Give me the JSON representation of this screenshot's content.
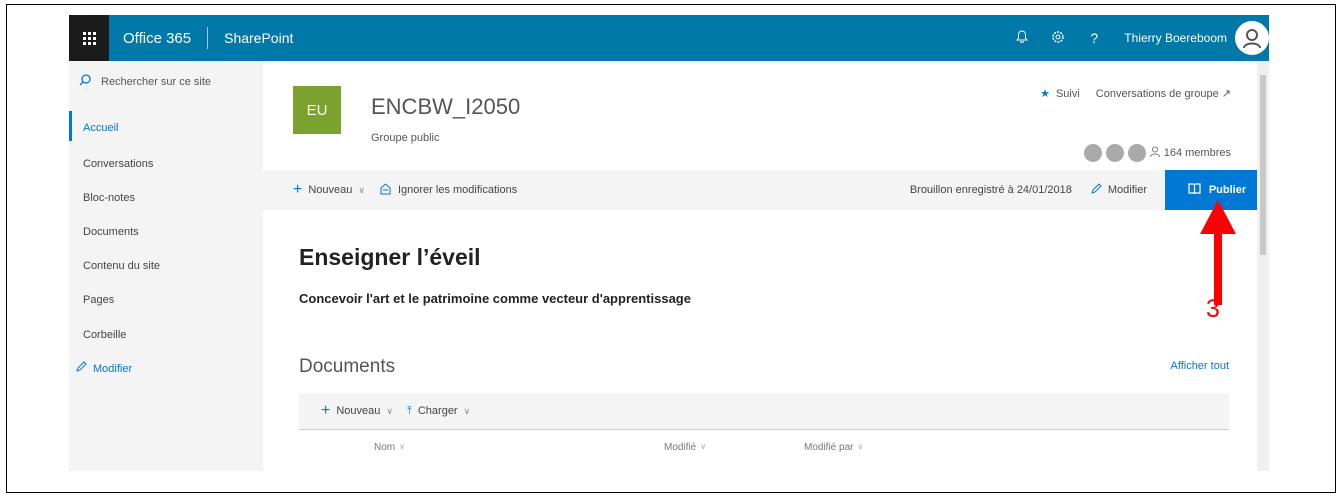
{
  "suitebar": {
    "brand": "Office 365",
    "app": "SharePoint",
    "user": "Thierry Boereboom",
    "icons": [
      "bell-icon",
      "gear-icon",
      "help-icon"
    ],
    "help_glyph": "?"
  },
  "leftnav": {
    "search_placeholder": "Rechercher sur ce site",
    "items": [
      {
        "label": "Accueil",
        "active": true
      },
      {
        "label": "Conversations"
      },
      {
        "label": "Bloc-notes"
      },
      {
        "label": "Documents"
      },
      {
        "label": "Contenu du site"
      },
      {
        "label": "Pages"
      },
      {
        "label": "Corbeille"
      }
    ],
    "edit_label": "Modifier"
  },
  "site": {
    "logo_text": "EU",
    "title": "ENCBW_I2050",
    "subtitle": "Groupe public",
    "follow_label": "Suivi",
    "conversations_label": "Conversations de groupe",
    "members_label": "164 membres",
    "logo_color": "#7ba22c"
  },
  "cmdbar": {
    "new_label": "Nouveau",
    "discard_label": "Ignorer les modifications",
    "draft_status": "Brouillon enregistré à 24/01/2018",
    "edit_label": "Modifier",
    "publish_label": "Publier",
    "accent": "#0078d4"
  },
  "page": {
    "title": "Enseigner l’éveil",
    "subtitle": "Concevoir l'art et le patrimoine comme vecteur d'apprentissage"
  },
  "documents": {
    "title": "Documents",
    "show_all": "Afficher tout",
    "new_label": "Nouveau",
    "upload_label": "Charger",
    "columns": [
      "Nom",
      "Modifié",
      "Modifié par"
    ]
  },
  "annotation": {
    "number": "3",
    "color": "#ff0000"
  }
}
